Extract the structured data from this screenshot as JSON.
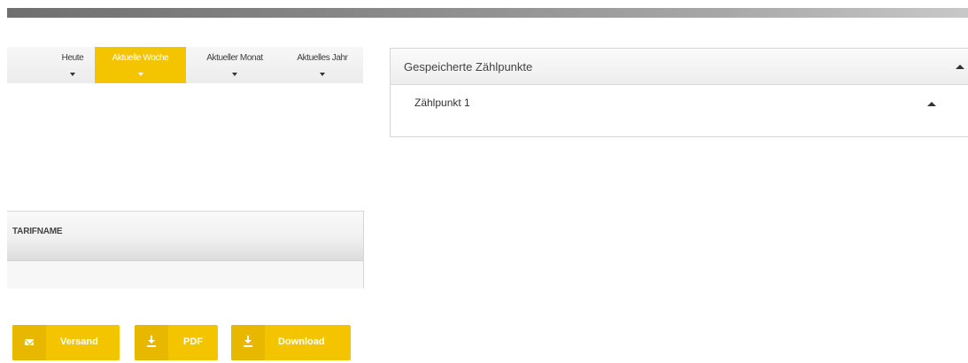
{
  "periods": {
    "tabs": [
      {
        "label": "Heute",
        "active": false
      },
      {
        "label": "Aktuelle Woche",
        "active": true
      },
      {
        "label": "Aktueller Monat",
        "active": false
      },
      {
        "label": "Aktuelles Jahr",
        "active": false
      }
    ]
  },
  "saved_meter_points": {
    "title": "Gespeicherte Zählpunkte",
    "items": [
      {
        "label": "Zählpunkt 1"
      }
    ]
  },
  "table": {
    "columns": [
      "TARIFNAME"
    ],
    "rows": [
      [
        ""
      ]
    ]
  },
  "actions": {
    "send_label": "Versand",
    "pdf_label": "PDF",
    "download_label": "Download"
  },
  "icons": {
    "send": "envelope-icon",
    "pdf": "download-arrow-icon",
    "download": "download-arrow-icon",
    "collapse": "caret-up-icon",
    "dropdown": "caret-down-icon"
  },
  "colors": {
    "accent": "#f5c400",
    "accent_dark": "#e8b800",
    "top_bar": "#8a8a8a"
  }
}
